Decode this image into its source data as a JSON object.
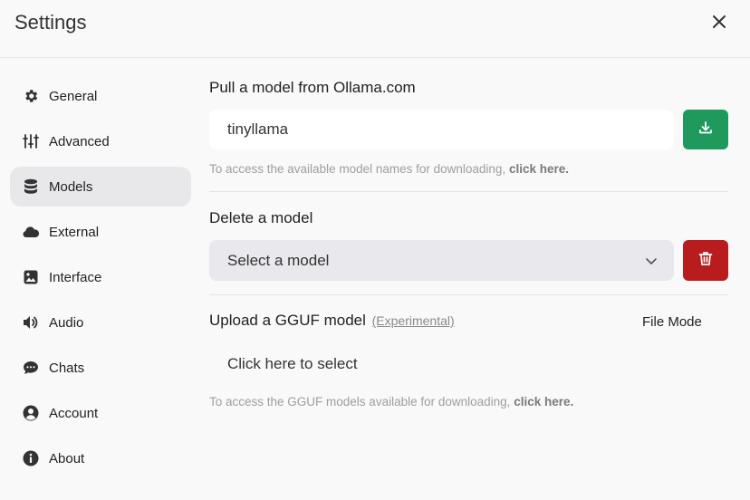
{
  "header": {
    "title": "Settings",
    "close_icon": "close-icon"
  },
  "sidebar": {
    "items": [
      {
        "label": "General",
        "icon": "gear-icon"
      },
      {
        "label": "Advanced",
        "icon": "sliders-icon"
      },
      {
        "label": "Models",
        "icon": "database-icon",
        "active": true
      },
      {
        "label": "External",
        "icon": "cloud-icon"
      },
      {
        "label": "Interface",
        "icon": "image-icon"
      },
      {
        "label": "Audio",
        "icon": "speaker-icon"
      },
      {
        "label": "Chats",
        "icon": "chat-bubble-icon"
      },
      {
        "label": "Account",
        "icon": "user-circle-icon"
      },
      {
        "label": "About",
        "icon": "info-icon"
      }
    ]
  },
  "pull": {
    "title": "Pull a model from Ollama.com",
    "input_value": "tinyllama",
    "hint_text": "To access the available model names for downloading,",
    "hint_link": "click here."
  },
  "delete": {
    "title": "Delete a model",
    "select_value": "Select a model"
  },
  "upload": {
    "title": "Upload a GGUF model",
    "experimental": "(Experimental)",
    "mode": "File Mode",
    "select_text": "Click here to select",
    "hint_text": "To access the GGUF models available for downloading,",
    "hint_link": "click here."
  },
  "colors": {
    "download_button": "#1f9a5c",
    "delete_button": "#b91c1c",
    "active_sidebar": "#e8e8ea"
  }
}
